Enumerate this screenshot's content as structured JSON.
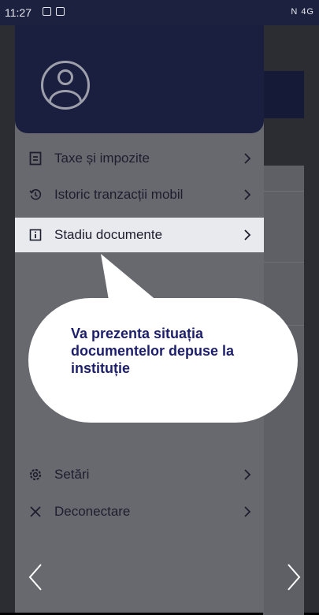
{
  "status_bar": {
    "time": "11:27",
    "right_icons": "N 4G"
  },
  "drawer": {
    "items_top": [
      {
        "label": "Taxe și impozite",
        "icon": "receipt-icon"
      },
      {
        "label": "Istoric tranzacții mobil",
        "icon": "history-icon"
      },
      {
        "label": "Stadiu documente",
        "icon": "info-doc-icon"
      }
    ],
    "items_bottom": [
      {
        "label": "Setări",
        "icon": "gear-icon"
      },
      {
        "label": "Deconectare",
        "icon": "close-icon"
      }
    ]
  },
  "tooltip": {
    "text": "Va prezenta situația documentelor depuse la instituție"
  },
  "colors": {
    "header": "#1b1f3f",
    "tooltip_text": "#1d1f6c",
    "active_row": "#e9eaee",
    "drawer_bg": "#68696e"
  }
}
